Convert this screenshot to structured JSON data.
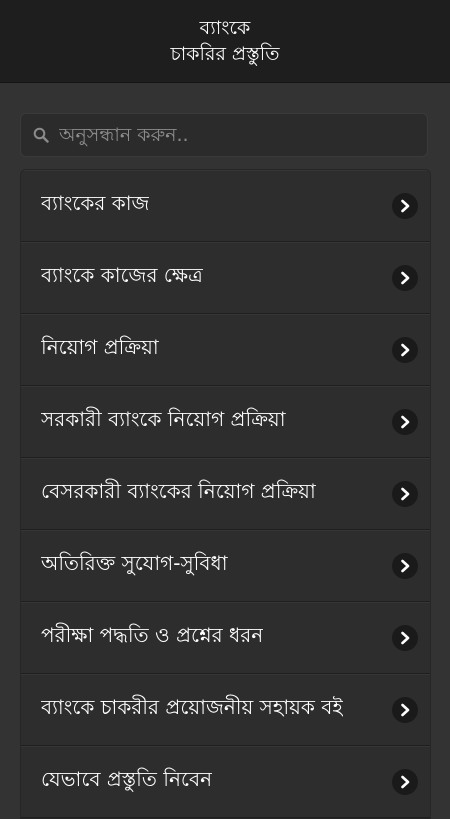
{
  "header": {
    "line1": "ব্যাংকে",
    "line2": "চাকরির প্রস্তুতি"
  },
  "search": {
    "placeholder": "অনুসন্ধান করুন..",
    "value": ""
  },
  "menu": {
    "items": [
      {
        "label": "ব্যাংকের কাজ"
      },
      {
        "label": "ব্যাংকে কাজের ক্ষেত্র"
      },
      {
        "label": "নিয়োগ প্রক্রিয়া"
      },
      {
        "label": "সরকারী ব্যাংকে নিয়োগ প্রক্রিয়া"
      },
      {
        "label": "বেসরকারী ব্যাংকের নিয়োগ প্রক্রিয়া"
      },
      {
        "label": "অতিরিক্ত সুযোগ-সুবিধা"
      },
      {
        "label": "পরীক্ষা পদ্ধতি ও প্রশ্নের ধরন"
      },
      {
        "label": "ব্যাংকে চাকরীর প্রয়োজনীয় সহায়ক বই"
      },
      {
        "label": "যেভাবে প্রস্তুতি নিবেন"
      }
    ]
  },
  "colors": {
    "header_bg": "#1e1e1e",
    "page_bg": "#333333",
    "item_bg": "#2d2d2d",
    "text": "#ffffff",
    "chevron_bg": "#1a1a1a"
  },
  "icons": {
    "search": "search-icon",
    "chevron": "chevron-right-icon"
  }
}
